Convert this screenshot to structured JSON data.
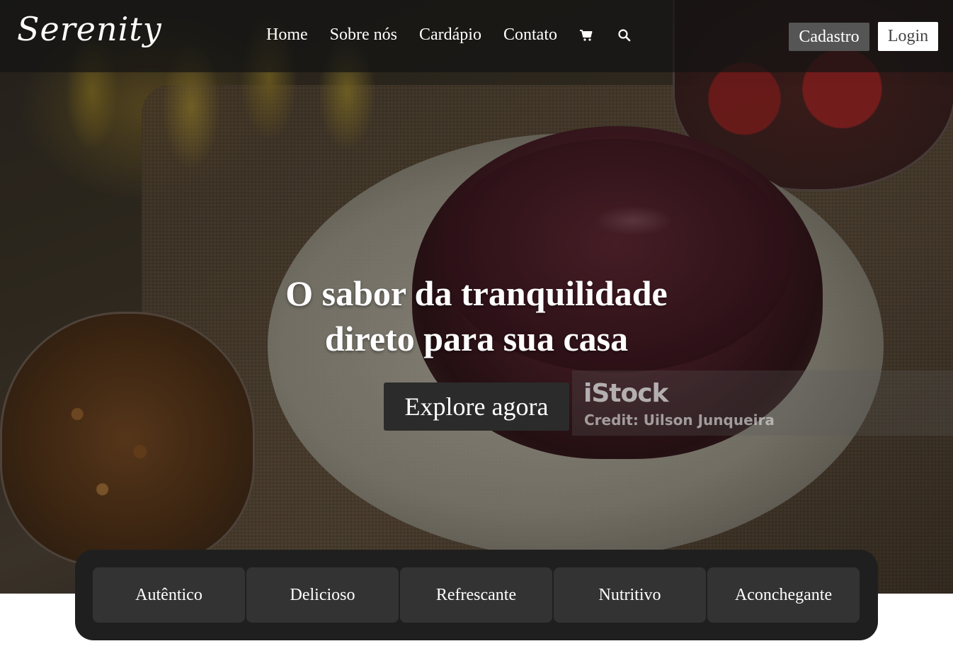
{
  "brand": {
    "logo_text": "Serenity"
  },
  "nav": {
    "links": [
      "Home",
      "Sobre nós",
      "Cardápio",
      "Contato"
    ],
    "icons": [
      "cart-icon",
      "search-icon"
    ],
    "signup_label": "Cadastro",
    "login_label": "Login"
  },
  "hero": {
    "headline_line1": "O sabor da tranquilidade",
    "headline_line2": "direto para sua casa",
    "cta_label": "Explore agora"
  },
  "watermark": {
    "logo": "iStock",
    "credit": "Credit: Uilson Junqueira"
  },
  "features": [
    "Autêntico",
    "Delicioso",
    "Refrescante",
    "Nutritivo",
    "Aconchegante"
  ],
  "colors": {
    "navbar_bg": "#141414",
    "signup_bg": "#555555",
    "login_bg": "#ffffff",
    "cta_bg": "#2b2b2b",
    "features_bg": "#1f1f1f",
    "feature_item_bg": "#333333"
  }
}
